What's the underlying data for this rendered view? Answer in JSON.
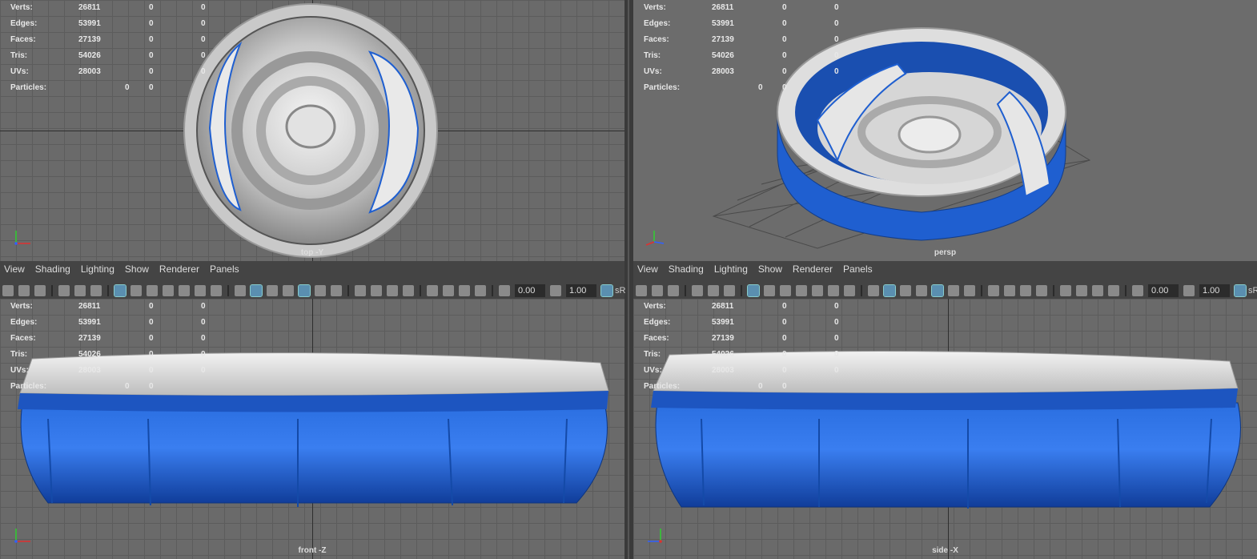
{
  "stats": {
    "labels": [
      "Verts:",
      "Edges:",
      "Faces:",
      "Tris:",
      "UVs:",
      "Particles:"
    ],
    "rows": [
      {
        "label": "Verts:",
        "c1": "26811",
        "c2": "0",
        "c3": "0"
      },
      {
        "label": "Edges:",
        "c1": "53991",
        "c2": "0",
        "c3": "0"
      },
      {
        "label": "Faces:",
        "c1": "27139",
        "c2": "0",
        "c3": "0"
      },
      {
        "label": "Tris:",
        "c1": "54026",
        "c2": "0",
        "c3": "0"
      },
      {
        "label": "UVs:",
        "c1": "28003",
        "c2": "0",
        "c3": "0"
      },
      {
        "label": "Particles:",
        "c1": "",
        "c2": "0",
        "c3": "0"
      }
    ]
  },
  "viewports": {
    "top": {
      "label": "top -Y"
    },
    "persp": {
      "label": "persp"
    },
    "front": {
      "label": "front -Z"
    },
    "side": {
      "label": "side -X"
    }
  },
  "panel_menu": [
    "View",
    "Shading",
    "Lighting",
    "Show",
    "Renderer",
    "Panels"
  ],
  "toolbar": {
    "exposure_value": "0.00",
    "gamma_value": "1.00",
    "color_space_label": "sR"
  },
  "icons": {
    "camera": "camera-icon",
    "grid": "grid-icon",
    "wireframe": "wireframe-icon",
    "smooth_shade": "smooth-shade-icon",
    "light": "light-icon",
    "exposure": "exposure-icon",
    "gamma": "gamma-icon",
    "axis": "axis-gizmo-icon"
  },
  "colors": {
    "pool_blue": "#1f5fd0",
    "pool_white": "#e6e6e6",
    "viewport_bg": "#6a6a6a",
    "grid_line": "#5c5c5c",
    "axis_x": "#e03030",
    "axis_y": "#30d030",
    "axis_z": "#3060ff"
  }
}
